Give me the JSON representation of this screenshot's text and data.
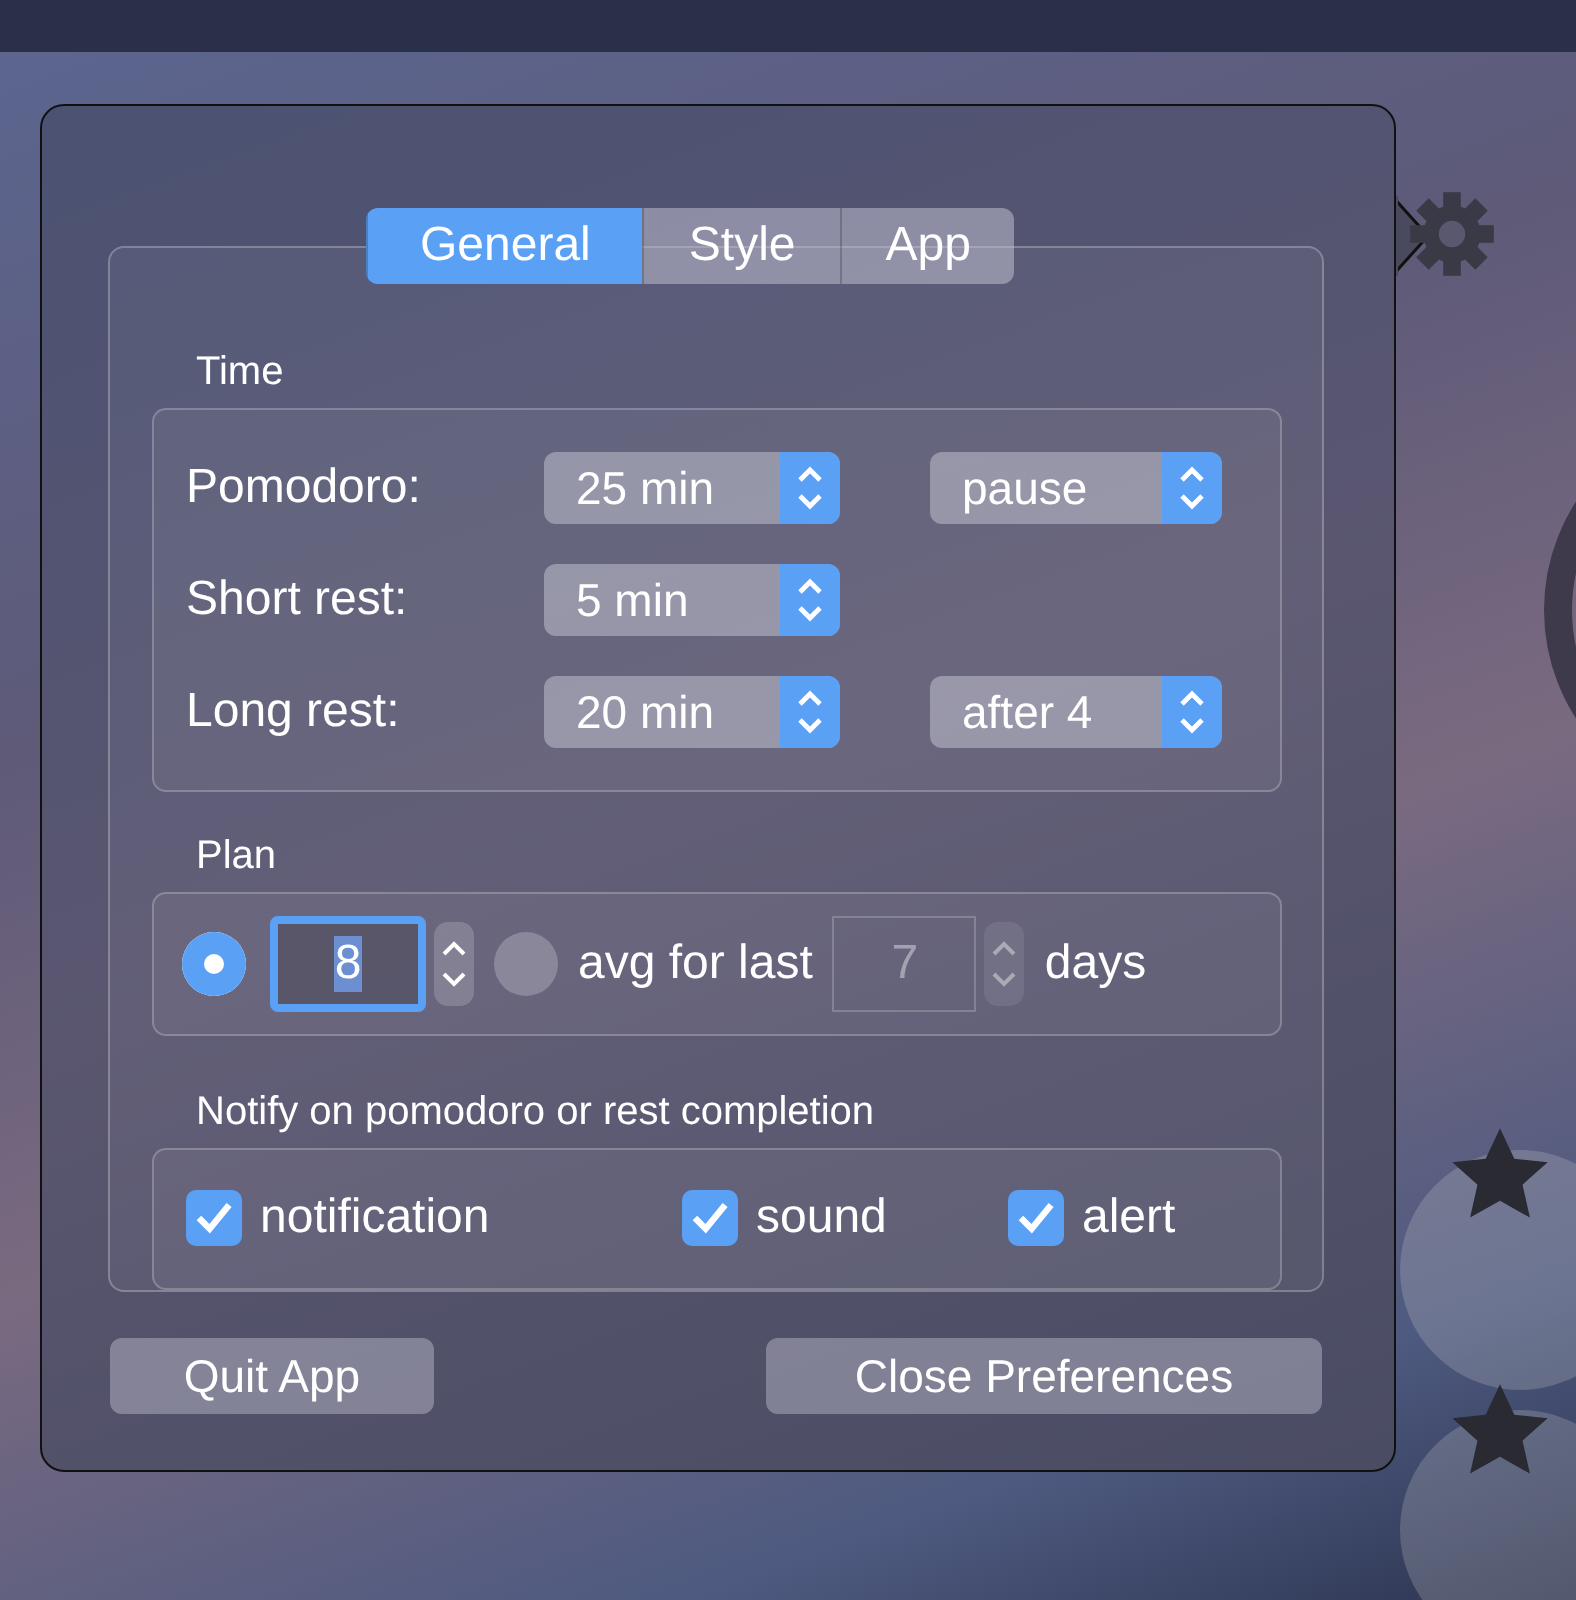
{
  "tabs": [
    {
      "label": "General",
      "selected": true
    },
    {
      "label": "Style",
      "selected": false
    },
    {
      "label": "App",
      "selected": false
    }
  ],
  "time": {
    "title": "Time",
    "rows": [
      {
        "label": "Pomodoro:",
        "value": "25 min",
        "extra": "pause"
      },
      {
        "label": "Short rest:",
        "value": "5 min"
      },
      {
        "label": "Long rest:",
        "value": "20 min",
        "extra": "after 4"
      }
    ]
  },
  "plan": {
    "title": "Plan",
    "options": [
      {
        "kind": "fixed",
        "selected": true,
        "value": "8"
      },
      {
        "kind": "average",
        "selected": false,
        "label": "avg for last",
        "value": "7",
        "unit": "days"
      }
    ]
  },
  "notify": {
    "title": "Notify on pomodoro or rest completion",
    "options": [
      {
        "label": "notification",
        "checked": true
      },
      {
        "label": "sound",
        "checked": true
      },
      {
        "label": "alert",
        "checked": true
      }
    ]
  },
  "buttons": [
    "Quit App",
    "Close Preferences"
  ]
}
